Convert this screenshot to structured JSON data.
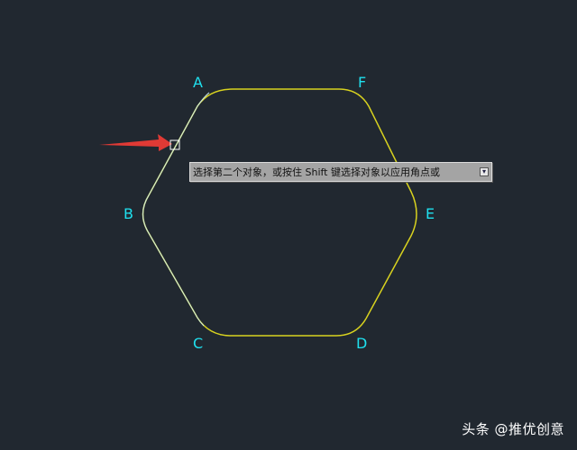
{
  "colors": {
    "background": "#212830",
    "shape_stroke": "#d8d21f",
    "selected_edge_stroke": "#cfeff2",
    "vertex_label": "#1fe0ee",
    "arrow": "#e03a35",
    "pickbox": "#ffffff"
  },
  "vertex_labels": {
    "A": "A",
    "F": "F",
    "B": "B",
    "E": "E",
    "C": "C",
    "D": "D"
  },
  "tooltip": {
    "text": "选择第二个对象，或按住 Shift 键选择对象以应用角点或",
    "button_icon": "down-arrow-icon"
  },
  "watermark": {
    "text": "头条 @推优创意"
  }
}
